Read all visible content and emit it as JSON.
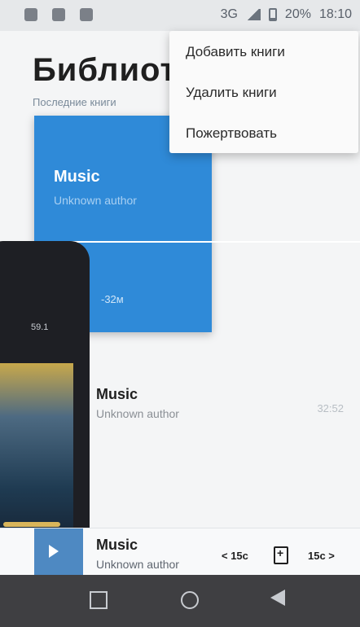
{
  "status_bar": {
    "network": "3G",
    "battery": "20%",
    "time": "18:10"
  },
  "title": "Библиоте",
  "recent_section": "Последние книги",
  "recent_card": {
    "title": "Music",
    "author": "Unknown author",
    "duration": "-32м"
  },
  "menu": {
    "items": [
      "Добавить книги",
      "Удалить книги",
      "Пожертвовать"
    ]
  },
  "book_list": [
    {
      "title": "Music",
      "author": "Unknown author",
      "duration": "32:52"
    }
  ],
  "player": {
    "title": "Music",
    "author": "Unknown author",
    "rewind": "< 15с",
    "forward": "15с >"
  },
  "overlay": {
    "text": "59.1"
  }
}
